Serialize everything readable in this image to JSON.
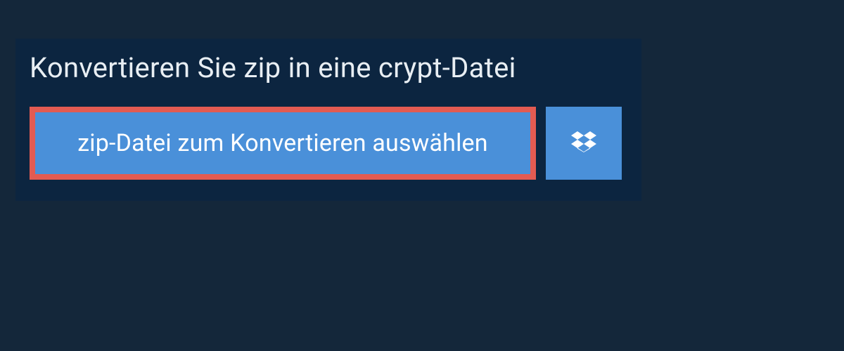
{
  "heading": "Konvertieren Sie zip in eine crypt-Datei",
  "buttons": {
    "select_file_label": "zip-Datei zum Konvertieren auswählen"
  },
  "colors": {
    "background": "#14273a",
    "panel": "#0c2540",
    "button_bg": "#4a90d9",
    "button_border": "#e35b52",
    "text_light": "#e8eef3"
  }
}
